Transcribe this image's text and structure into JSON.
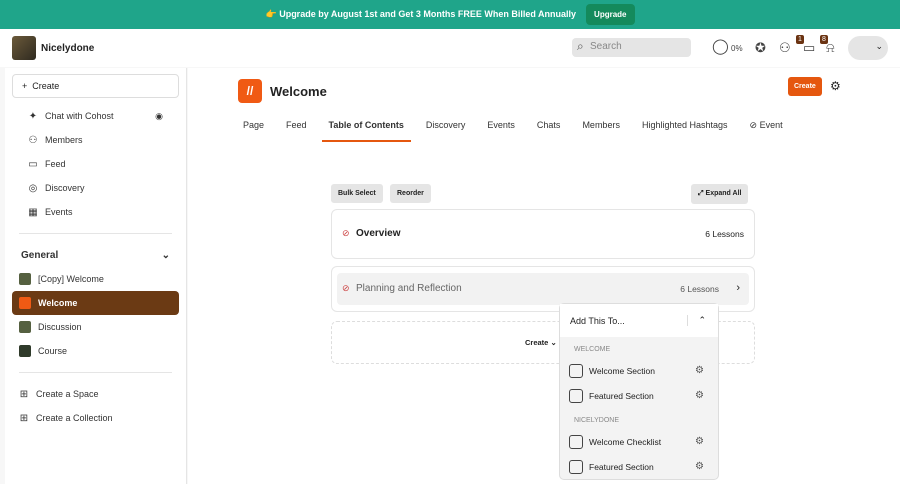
{
  "banner": {
    "text": "👉 Upgrade by August 1st and Get 3 Months FREE When Billed Annually",
    "button": "Upgrade"
  },
  "header": {
    "brand": "Nicelydone",
    "search_placeholder": "Search",
    "progress": "0%",
    "badge_chat": "1",
    "badge_notif": "8"
  },
  "sidebar": {
    "create": "Create",
    "items": [
      {
        "label": "Chat with Cohost"
      },
      {
        "label": "Members"
      },
      {
        "label": "Feed"
      },
      {
        "label": "Discovery"
      },
      {
        "label": "Events"
      }
    ],
    "section": "General",
    "spaces": [
      {
        "label": "[Copy] Welcome"
      },
      {
        "label": "Welcome"
      },
      {
        "label": "Discussion"
      },
      {
        "label": "Course"
      }
    ],
    "create_space": "Create a Space",
    "create_collection": "Create a Collection"
  },
  "main": {
    "title": "Welcome",
    "create": "Create",
    "tabs": [
      "Page",
      "Feed",
      "Table of Contents",
      "Discovery",
      "Events",
      "Chats",
      "Members",
      "Highlighted Hashtags",
      "Event"
    ],
    "bulk_select": "Bulk Select",
    "reorder": "Reorder",
    "expand_all": "Expand All",
    "sections": [
      {
        "title": "Overview",
        "count": "6 Lessons"
      },
      {
        "title": "Planning and Reflection",
        "count": "6 Lessons"
      }
    ],
    "create_dropdown": "Create"
  },
  "popup": {
    "title": "Add This To...",
    "groups": [
      {
        "caption": "WELCOME",
        "items": [
          "Welcome Section",
          "Featured Section"
        ]
      },
      {
        "caption": "NICELYDONE",
        "items": [
          "Welcome Checklist",
          "Featured Section"
        ]
      }
    ]
  }
}
